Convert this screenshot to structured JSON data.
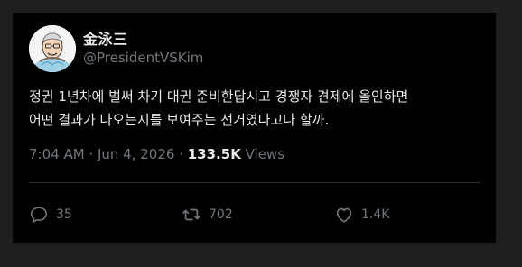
{
  "author": {
    "display_name": "金泳三",
    "handle": "@PresidentVSKim"
  },
  "tweet": {
    "lines": [
      "정권 1년차에 벌써 차기 대권 준비한답시고 경쟁자 견제에 올인하면",
      "어떤 결과가 나오는지를 보여주는 선거였다고나 할까."
    ]
  },
  "meta": {
    "time": "7:04 AM",
    "separator": " · ",
    "date": "Jun 4, 2026",
    "views_count": "133.5K",
    "views_label": " Views"
  },
  "actions": {
    "replies": "35",
    "reposts": "702",
    "likes": "1.4K"
  },
  "colors": {
    "background": "#000000",
    "text": "#e7e9ea",
    "secondary": "#71767b",
    "page": "#1f1f1f"
  },
  "icons": [
    "reply-icon",
    "repost-icon",
    "like-icon"
  ]
}
